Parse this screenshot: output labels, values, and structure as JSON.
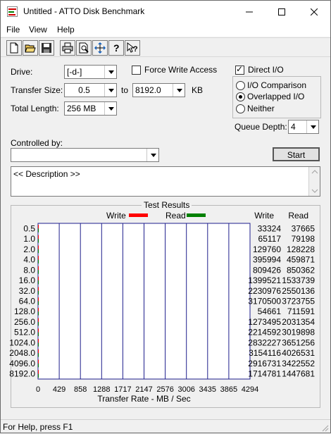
{
  "window": {
    "title": "Untitled - ATTO Disk Benchmark"
  },
  "menu": {
    "file": "File",
    "view": "View",
    "help": "Help"
  },
  "toolbar": [
    "new-icon",
    "open-icon",
    "save-icon",
    "print-icon",
    "print-preview-icon",
    "move-icon",
    "help-icon",
    "context-help-icon"
  ],
  "settings": {
    "drive_label": "Drive:",
    "drive_value": "[-d-]",
    "transfer_size_label": "Transfer Size:",
    "transfer_from": "0.5",
    "to_label": "to",
    "transfer_to": "8192.0",
    "kb_label": "KB",
    "total_length_label": "Total Length:",
    "total_length_value": "256 MB",
    "force_write_label": "Force Write Access",
    "force_write_checked": false,
    "direct_io_label": "Direct I/O",
    "direct_io_checked": true,
    "io_comparison_label": "I/O Comparison",
    "overlapped_io_label": "Overlapped I/O",
    "neither_label": "Neither",
    "io_mode_selected": "overlapped",
    "queue_depth_label": "Queue Depth:",
    "queue_depth_value": "4",
    "controlled_by_label": "Controlled by:",
    "controlled_by_value": "",
    "start_label": "Start",
    "description_text": "<< Description >>"
  },
  "results": {
    "group_title": "Test Results",
    "write_label": "Write",
    "read_label": "Read",
    "write_column": "Write",
    "read_column": "Read",
    "x_axis_label": "Transfer Rate - MB / Sec",
    "rows": [
      {
        "size": "0.5",
        "write": "33324",
        "read": "37665"
      },
      {
        "size": "1.0",
        "write": "65117",
        "read": "79198"
      },
      {
        "size": "2.0",
        "write": "129760",
        "read": "128228"
      },
      {
        "size": "4.0",
        "write": "395994",
        "read": "459871"
      },
      {
        "size": "8.0",
        "write": "809426",
        "read": "850362"
      },
      {
        "size": "16.0",
        "write": "1399521",
        "read": "1533739"
      },
      {
        "size": "32.0",
        "write": "2230976",
        "read": "2550136"
      },
      {
        "size": "64.0",
        "write": "3170500",
        "read": "3723755"
      },
      {
        "size": "128.0",
        "write": "54661",
        "read": "711591"
      },
      {
        "size": "256.0",
        "write": "1273495",
        "read": "2031354"
      },
      {
        "size": "512.0",
        "write": "2214592",
        "read": "3019898"
      },
      {
        "size": "1024.0",
        "write": "2832227",
        "read": "3651256"
      },
      {
        "size": "2048.0",
        "write": "3154116",
        "read": "4026531"
      },
      {
        "size": "4096.0",
        "write": "2916731",
        "read": "3422552"
      },
      {
        "size": "8192.0",
        "write": "1714781",
        "read": "1447681"
      }
    ]
  },
  "chart_data": {
    "type": "bar",
    "orientation": "horizontal",
    "xlabel": "Transfer Rate - MB / Sec",
    "xlim": [
      0,
      4294
    ],
    "x_ticks": [
      "0",
      "429",
      "858",
      "1288",
      "1717",
      "2147",
      "2576",
      "3006",
      "3435",
      "3865",
      "4294"
    ],
    "categories": [
      "0.5",
      "1.0",
      "2.0",
      "4.0",
      "8.0",
      "16.0",
      "32.0",
      "64.0",
      "128.0",
      "256.0",
      "512.0",
      "1024.0",
      "2048.0",
      "4096.0",
      "8192.0"
    ],
    "series": [
      {
        "name": "Write",
        "color": "#ff0000",
        "values": [
          33324,
          65117,
          129760,
          395994,
          809426,
          1399521,
          2230976,
          3170500,
          54661,
          1273495,
          2214592,
          2832227,
          3154116,
          2916731,
          1714781
        ]
      },
      {
        "name": "Read",
        "color": "#008000",
        "values": [
          37665,
          79198,
          128228,
          459871,
          850362,
          1533739,
          2550136,
          3723755,
          711591,
          2031354,
          3019898,
          3651256,
          4026531,
          3422552,
          1447681
        ]
      }
    ],
    "value_scale_note_units": "bytes/sec values; chart axis in MB/Sec"
  },
  "status": {
    "text": "For Help, press F1"
  }
}
